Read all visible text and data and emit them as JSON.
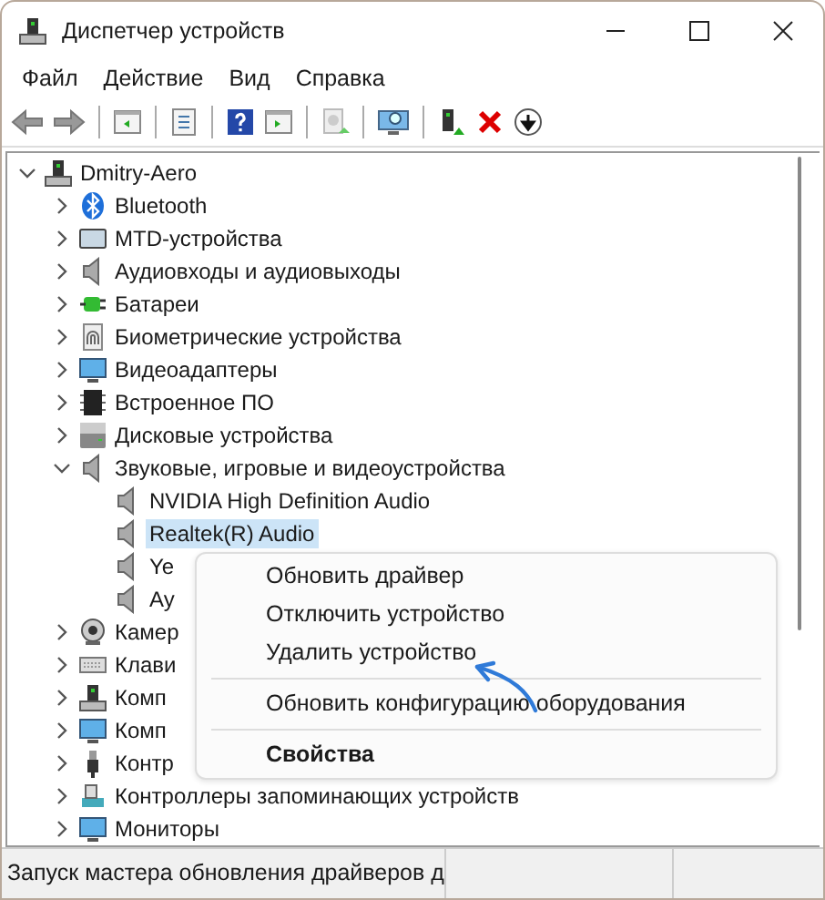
{
  "window": {
    "title": "Диспетчер устройств"
  },
  "menu": [
    "Файл",
    "Действие",
    "Вид",
    "Справка"
  ],
  "tree": [
    {
      "label": "Dmitry-Aero",
      "expanded": true,
      "selected": false,
      "children": [
        {
          "label": "Bluetooth",
          "expanded": false,
          "selected": false
        },
        {
          "label": "MTD-устройства",
          "expanded": false,
          "selected": false
        },
        {
          "label": "Аудиовходы и аудиовыходы",
          "expanded": false,
          "selected": false
        },
        {
          "label": "Батареи",
          "expanded": false,
          "selected": false
        },
        {
          "label": "Биометрические устройства",
          "expanded": false,
          "selected": false
        },
        {
          "label": "Видеоадаптеры",
          "expanded": false,
          "selected": false
        },
        {
          "label": "Встроенное ПО",
          "expanded": false,
          "selected": false
        },
        {
          "label": "Дисковые устройства",
          "expanded": false,
          "selected": false
        },
        {
          "label": "Звуковые, игровые и видеоустройства",
          "expanded": true,
          "selected": false,
          "children": [
            {
              "label": "NVIDIA High Definition Audio",
              "selected": false
            },
            {
              "label": "Realtek(R) Audio",
              "selected": true
            },
            {
              "label": "Ye",
              "selected": false
            },
            {
              "label": "Ау",
              "selected": false
            }
          ]
        },
        {
          "label": "Камер",
          "expanded": false,
          "selected": false
        },
        {
          "label": "Клави",
          "expanded": false,
          "selected": false
        },
        {
          "label": "Комп",
          "expanded": false,
          "selected": false
        },
        {
          "label": "Комп",
          "expanded": false,
          "selected": false
        },
        {
          "label": "Контр",
          "expanded": false,
          "selected": false
        },
        {
          "label": "Контроллеры запоминающих устройств",
          "expanded": false,
          "selected": false
        },
        {
          "label": "Мониторы",
          "expanded": false,
          "selected": false
        }
      ]
    }
  ],
  "context_menu": [
    {
      "kind": "item",
      "label": "Обновить драйвер"
    },
    {
      "kind": "item",
      "label": "Отключить устройство"
    },
    {
      "kind": "item",
      "label": "Удалить устройство"
    },
    {
      "kind": "separator"
    },
    {
      "kind": "item",
      "label": "Обновить конфигурацию оборудования"
    },
    {
      "kind": "separator"
    },
    {
      "kind": "default",
      "label": "Свойства"
    }
  ],
  "status_bar": "Запуск мастера обновления драйверов д"
}
